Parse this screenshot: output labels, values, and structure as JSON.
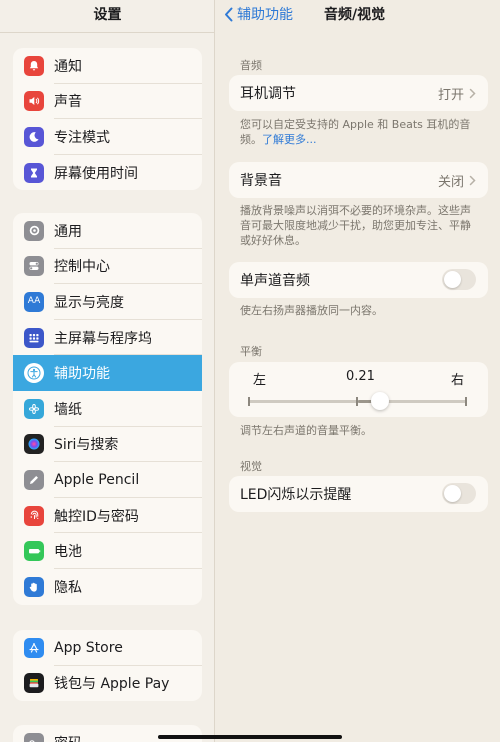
{
  "sidebar": {
    "title": "设置",
    "groups": [
      {
        "items": [
          {
            "label": "通知",
            "icon": "bell-icon",
            "color": "#e8453c",
            "glyph": "🔔"
          },
          {
            "label": "声音",
            "icon": "speaker-icon",
            "color": "#e8453c",
            "glyph": "🔊"
          },
          {
            "label": "专注模式",
            "icon": "moon-icon",
            "color": "#5856d6",
            "glyph": "☾"
          },
          {
            "label": "屏幕使用时间",
            "icon": "hourglass-icon",
            "color": "#5856d6",
            "glyph": "⧗"
          }
        ]
      },
      {
        "items": [
          {
            "label": "通用",
            "icon": "gear-icon",
            "color": "#8e8e93",
            "glyph": "⚙"
          },
          {
            "label": "控制中心",
            "icon": "toggles-icon",
            "color": "#8e8e93",
            "glyph": "◧"
          },
          {
            "label": "显示与亮度",
            "icon": "text-size-icon",
            "color": "#2f7ad6",
            "glyph": "AA"
          },
          {
            "label": "主屏幕与程序坞",
            "icon": "home-grid-icon",
            "color": "#3c57c9",
            "glyph": "▦"
          },
          {
            "label": "辅助功能",
            "icon": "accessibility-icon",
            "color": "#2f7ad6",
            "glyph": "♿",
            "active": true
          },
          {
            "label": "墙纸",
            "icon": "flower-icon",
            "color": "#36a7d9",
            "glyph": "✿"
          },
          {
            "label": "Siri与搜索",
            "icon": "siri-icon",
            "color": "#222222",
            "glyph": "◉"
          },
          {
            "label": "Apple Pencil",
            "icon": "pencil-icon",
            "color": "#8e8e93",
            "glyph": "✎"
          },
          {
            "label": "触控ID与密码",
            "icon": "fingerprint-icon",
            "color": "#e8453c",
            "glyph": "◎"
          },
          {
            "label": "电池",
            "icon": "battery-icon",
            "color": "#34c759",
            "glyph": "▬"
          },
          {
            "label": "隐私",
            "icon": "hand-icon",
            "color": "#2f7ad6",
            "glyph": "✋"
          }
        ]
      },
      {
        "items": [
          {
            "label": "App Store",
            "icon": "app-store-icon",
            "color": "#2f8cf0",
            "glyph": "A"
          },
          {
            "label": "钱包与 Apple Pay",
            "icon": "wallet-icon",
            "color": "#1c1c1e",
            "glyph": "▤"
          }
        ]
      },
      {
        "items": [
          {
            "label": "密码",
            "icon": "key-icon",
            "color": "#8e8e93",
            "glyph": "⚿"
          }
        ]
      }
    ]
  },
  "nav": {
    "back_label": "辅助功能",
    "title": "音频/视觉"
  },
  "audio": {
    "header": "音频",
    "headphone_label": "耳机调节",
    "headphone_value": "打开",
    "headphone_note": "您可以自定受支持的 Apple 和 Beats 耳机的音频。",
    "learn_more": "了解更多...",
    "background_label": "背景音",
    "background_value": "关闭",
    "background_note": "播放背景噪声以消弭不必要的环境杂声。这些声音可最大限度地减少干扰，助您更加专注、平静或好好休息。",
    "mono_label": "单声道音频",
    "mono_note": "使左右扬声器播放同一内容。"
  },
  "balance": {
    "header": "平衡",
    "left": "左",
    "value": "0.21",
    "right": "右",
    "level": 0.21,
    "note": "调节左右声道的音量平衡。"
  },
  "visual": {
    "header": "视觉",
    "led_label": "LED闪烁以示提醒"
  }
}
